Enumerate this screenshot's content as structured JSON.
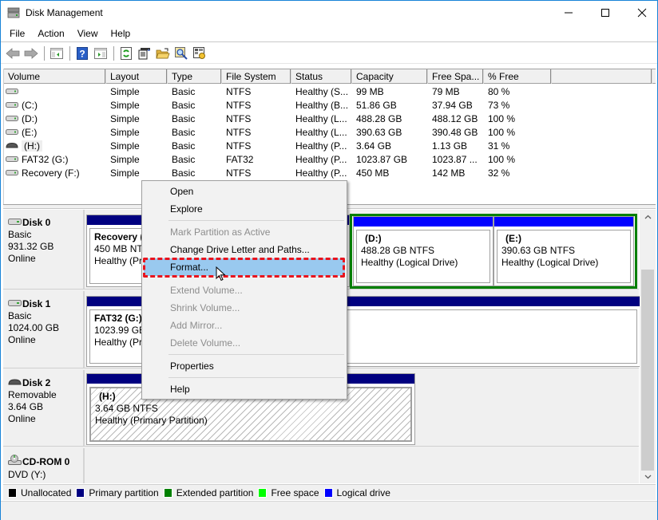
{
  "window": {
    "title": "Disk Management",
    "controls": {
      "minimize": "minimize",
      "maximize": "maximize",
      "close": "close"
    }
  },
  "menubar": {
    "items": [
      {
        "label": "File"
      },
      {
        "label": "Action"
      },
      {
        "label": "View"
      },
      {
        "label": "Help"
      }
    ]
  },
  "toolbar": {
    "buttons": [
      "back-icon",
      "forward-icon",
      "show-hide-console-tree-icon",
      "help-icon",
      "show-hide-action-pane-icon",
      "refresh-icon",
      "properties-icon",
      "open-folder-icon",
      "search-icon",
      "settings-icon"
    ]
  },
  "volume_list": {
    "columns": [
      "Volume",
      "Layout",
      "Type",
      "File System",
      "Status",
      "Capacity",
      "Free Spa...",
      "% Free"
    ],
    "rows": [
      {
        "volume": "",
        "layout": "Simple",
        "type": "Basic",
        "fs": "NTFS",
        "status": "Healthy (S...",
        "capacity": "99 MB",
        "free": "79 MB",
        "pct": "80 %",
        "icon": "disk"
      },
      {
        "volume": "(C:)",
        "layout": "Simple",
        "type": "Basic",
        "fs": "NTFS",
        "status": "Healthy (B...",
        "capacity": "51.86 GB",
        "free": "37.94 GB",
        "pct": "73 %",
        "icon": "disk"
      },
      {
        "volume": "(D:)",
        "layout": "Simple",
        "type": "Basic",
        "fs": "NTFS",
        "status": "Healthy (L...",
        "capacity": "488.28 GB",
        "free": "488.12 GB",
        "pct": "100 %",
        "icon": "disk"
      },
      {
        "volume": "(E:)",
        "layout": "Simple",
        "type": "Basic",
        "fs": "NTFS",
        "status": "Healthy (L...",
        "capacity": "390.63 GB",
        "free": "390.48 GB",
        "pct": "100 %",
        "icon": "disk"
      },
      {
        "volume": "(H:)",
        "layout": "Simple",
        "type": "Basic",
        "fs": "NTFS",
        "status": "Healthy (P...",
        "capacity": "3.64 GB",
        "free": "1.13 GB",
        "pct": "31 %",
        "icon": "removable",
        "selected": true
      },
      {
        "volume": "FAT32 (G:)",
        "layout": "Simple",
        "type": "Basic",
        "fs": "FAT32",
        "status": "Healthy (P...",
        "capacity": "1023.87 GB",
        "free": "1023.87 ...",
        "pct": "100 %",
        "icon": "disk"
      },
      {
        "volume": "Recovery (F:)",
        "layout": "Simple",
        "type": "Basic",
        "fs": "NTFS",
        "status": "Healthy (P...",
        "capacity": "450 MB",
        "free": "142 MB",
        "pct": "32 %",
        "icon": "disk"
      }
    ]
  },
  "disks": [
    {
      "name": "Disk 0",
      "kind": "Basic",
      "size": "931.32 GB",
      "state": "Online",
      "partitions": [
        {
          "name": "Recovery  (",
          "line2": "450 MB NTF",
          "line3": "Healthy (Pri"
        },
        {
          "name": "(D:)",
          "line2": "488.28 GB NTFS",
          "line3": "Healthy (Logical Drive)"
        },
        {
          "name": "(E:)",
          "line2": "390.63 GB NTFS",
          "line3": "Healthy (Logical Drive)"
        }
      ]
    },
    {
      "name": "Disk 1",
      "kind": "Basic",
      "size": "1024.00 GB",
      "state": "Online",
      "partitions": [
        {
          "name": "FAT32  (G:)",
          "line2": "1023.99 GB I",
          "line3": "Healthy (Pri"
        }
      ]
    },
    {
      "name": "Disk 2",
      "kind": "Removable",
      "size": "3.64 GB",
      "state": "Online",
      "partitions": [
        {
          "name": "(H:)",
          "line2": "3.64 GB NTFS",
          "line3": "Healthy (Primary Partition)"
        }
      ]
    },
    {
      "name": "CD-ROM 0",
      "kind": "DVD (Y:)"
    }
  ],
  "legend": [
    {
      "label": "Unallocated",
      "color": "#000000"
    },
    {
      "label": "Primary partition",
      "color": "#000080"
    },
    {
      "label": "Extended partition",
      "color": "#008000"
    },
    {
      "label": "Free space",
      "color": "#00ff00"
    },
    {
      "label": "Logical drive",
      "color": "#0000ff"
    }
  ],
  "context_menu": {
    "items": [
      {
        "label": "Open",
        "enabled": true
      },
      {
        "label": "Explore",
        "enabled": true
      },
      {
        "label": "Mark Partition as Active",
        "enabled": false
      },
      {
        "label": "Change Drive Letter and Paths...",
        "enabled": true
      },
      {
        "label": "Format...",
        "enabled": true,
        "highlighted": true
      },
      {
        "label": "Extend Volume...",
        "enabled": false
      },
      {
        "label": "Shrink Volume...",
        "enabled": false
      },
      {
        "label": "Add Mirror...",
        "enabled": false
      },
      {
        "label": "Delete Volume...",
        "enabled": false
      },
      {
        "label": "Properties",
        "enabled": true
      },
      {
        "label": "Help",
        "enabled": true
      }
    ]
  },
  "colors": {
    "primary_partition": "#000080",
    "logical_drive": "#0000ff",
    "extended_partition": "#008000",
    "menu_highlight": "#99c9ef",
    "annotation_red": "#e8141e"
  }
}
